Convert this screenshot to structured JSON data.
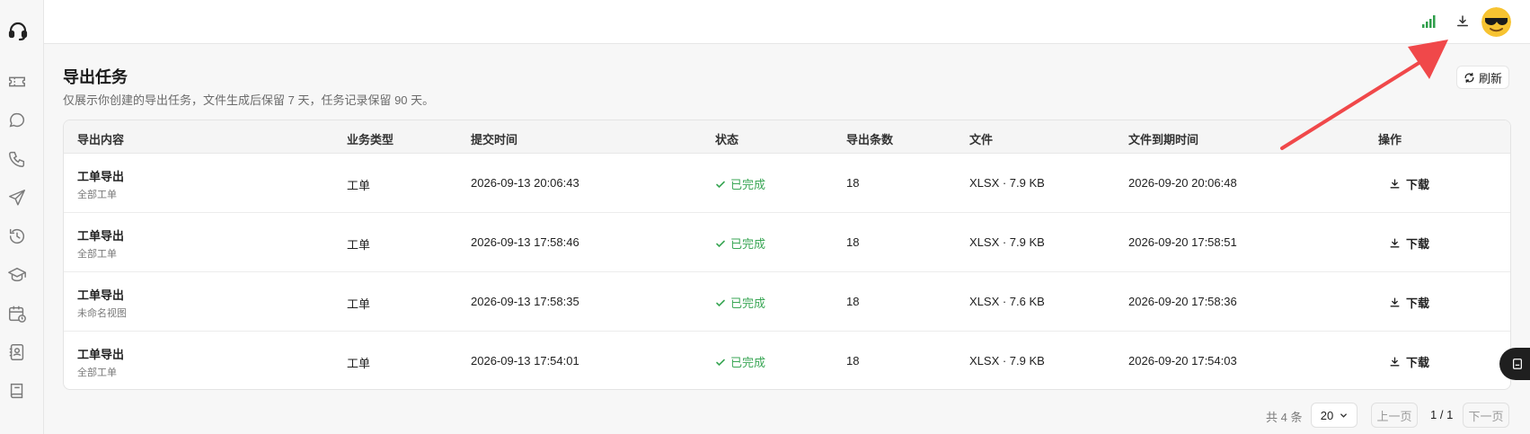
{
  "sidebar": {
    "items": [
      {
        "icon": "ticket-icon"
      },
      {
        "icon": "chat-icon"
      },
      {
        "icon": "phone-icon"
      },
      {
        "icon": "send-icon"
      },
      {
        "icon": "history-icon"
      },
      {
        "icon": "graduation-cap-icon"
      },
      {
        "icon": "calendar-clock-icon"
      },
      {
        "icon": "contacts-book-icon"
      },
      {
        "icon": "book-icon"
      }
    ]
  },
  "page": {
    "title": "导出任务",
    "subtitle": "仅展示你创建的导出任务，文件生成后保留 7 天，任务记录保留 90 天。",
    "refresh_label": "刷新"
  },
  "table": {
    "headers": {
      "content": "导出内容",
      "type": "业务类型",
      "submitted": "提交时间",
      "status": "状态",
      "count": "导出条数",
      "file": "文件",
      "expires": "文件到期时间",
      "action": "操作"
    },
    "rows": [
      {
        "title": "工单导出",
        "subtitle": "全部工单",
        "type": "工单",
        "submitted": "2026-09-13 20:06:43",
        "status": "已完成",
        "count": "18",
        "file": "XLSX · 7.9 KB",
        "expires": "2026-09-20 20:06:48",
        "action": "下载"
      },
      {
        "title": "工单导出",
        "subtitle": "全部工单",
        "type": "工单",
        "submitted": "2026-09-13 17:58:46",
        "status": "已完成",
        "count": "18",
        "file": "XLSX · 7.9 KB",
        "expires": "2026-09-20 17:58:51",
        "action": "下载"
      },
      {
        "title": "工单导出",
        "subtitle": "未命名视图",
        "type": "工单",
        "submitted": "2026-09-13 17:58:35",
        "status": "已完成",
        "count": "18",
        "file": "XLSX · 7.6 KB",
        "expires": "2026-09-20 17:58:36",
        "action": "下载"
      },
      {
        "title": "工单导出",
        "subtitle": "全部工单",
        "type": "工单",
        "submitted": "2026-09-13 17:54:01",
        "status": "已完成",
        "count": "18",
        "file": "XLSX · 7.9 KB",
        "expires": "2026-09-20 17:54:03",
        "action": "下载"
      }
    ]
  },
  "pagination": {
    "total": "共 4 条",
    "page_size": "20",
    "prev": "上一页",
    "page_info": "1 / 1",
    "next": "下一页"
  },
  "colors": {
    "status_done": "#3aa655",
    "signal": "#2e9e4a",
    "annotation_arrow": "#f0484a"
  }
}
